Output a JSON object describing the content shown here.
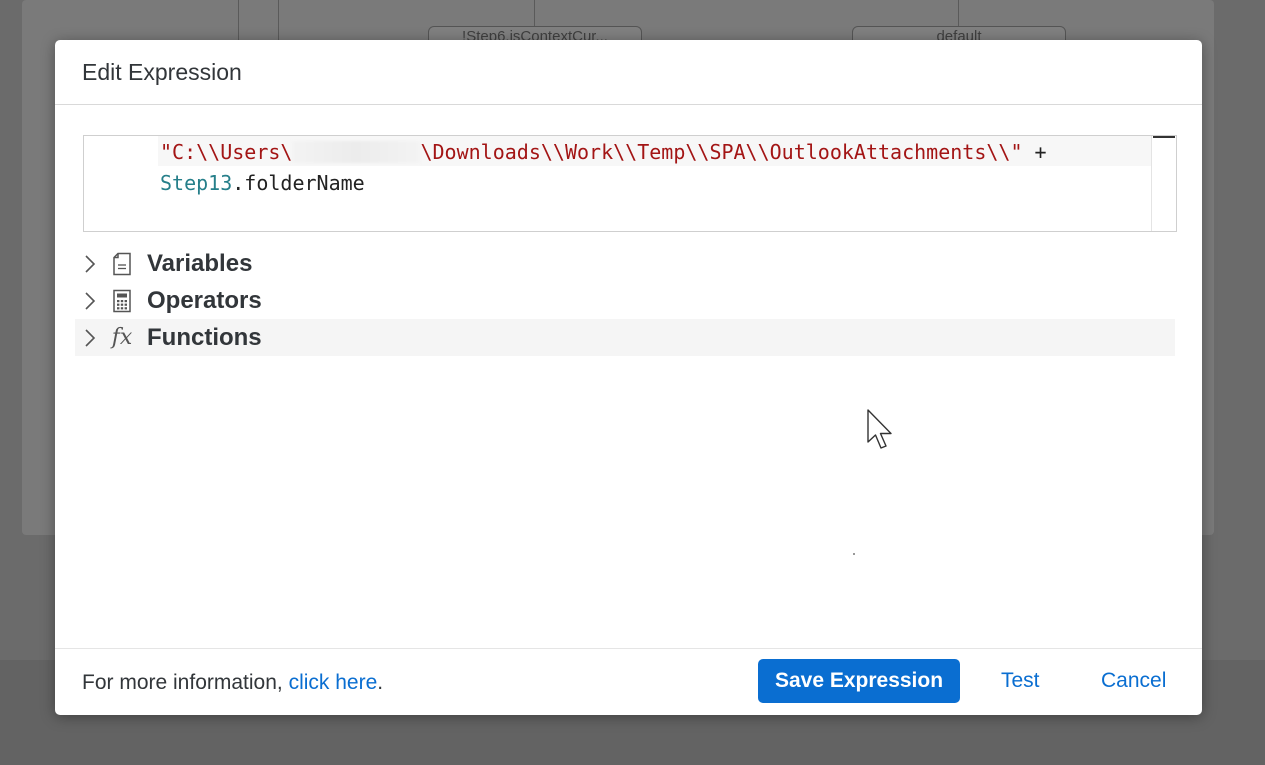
{
  "background": {
    "nodes": [
      "!Step6.isContextCur...",
      "default"
    ]
  },
  "dialog": {
    "title": "Edit Expression",
    "editor": {
      "line1": {
        "string_start": "\"C:\\\\Users\\",
        "string_end": "\\Downloads\\\\Work\\\\Temp\\\\SPA\\\\OutlookAttachments\\\\\"",
        "operator": " +"
      },
      "line2": {
        "variable": "Step13",
        "property": ".folderName"
      }
    },
    "tree": [
      {
        "label": "Variables",
        "icon": "document-icon"
      },
      {
        "label": "Operators",
        "icon": "calculator-icon"
      },
      {
        "label": "Functions",
        "icon": "fx-icon",
        "icon_text": "fx"
      }
    ],
    "footer": {
      "info_prefix": "For more information, ",
      "info_link": "click here",
      "info_suffix": ".",
      "save_label": "Save Expression",
      "test_label": "Test",
      "cancel_label": "Cancel"
    }
  },
  "colors": {
    "primary": "#0a6ed1",
    "string": "#a31515",
    "variable": "#267f8a"
  }
}
